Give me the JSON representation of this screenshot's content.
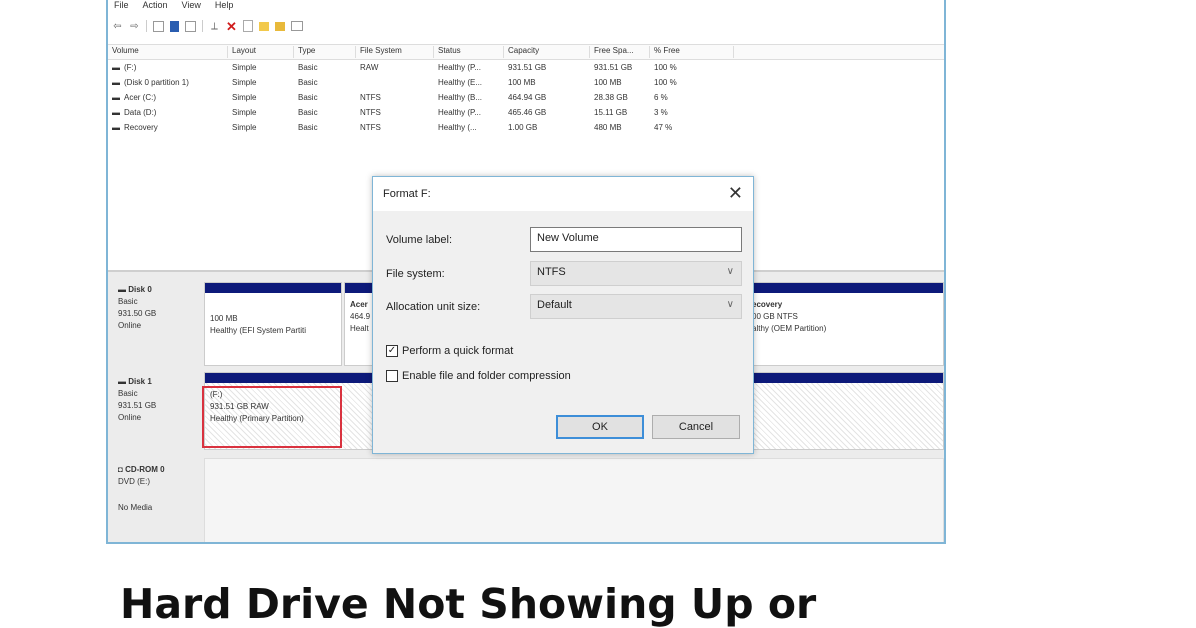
{
  "menubar": [
    "File",
    "Action",
    "View",
    "Help"
  ],
  "toolbar_icons": [
    "back-icon",
    "forward-icon",
    "console-tree-icon",
    "properties-icon",
    "help-icon",
    "connect-icon",
    "delete-icon",
    "checklist-icon",
    "folder-icon",
    "folder-open-icon",
    "window-icon"
  ],
  "volumes": {
    "columns": [
      "Volume",
      "Layout",
      "Type",
      "File System",
      "Status",
      "Capacity",
      "Free Spa...",
      "% Free"
    ],
    "rows": [
      [
        "(F:)",
        "Simple",
        "Basic",
        "RAW",
        "Healthy (P...",
        "931.51 GB",
        "931.51 GB",
        "100 %"
      ],
      [
        "(Disk 0 partition 1)",
        "Simple",
        "Basic",
        "",
        "Healthy (E...",
        "100 MB",
        "100 MB",
        "100 %"
      ],
      [
        "Acer (C:)",
        "Simple",
        "Basic",
        "NTFS",
        "Healthy (B...",
        "464.94 GB",
        "28.38 GB",
        "6 %"
      ],
      [
        "Data (D:)",
        "Simple",
        "Basic",
        "NTFS",
        "Healthy (P...",
        "465.46 GB",
        "15.11 GB",
        "3 %"
      ],
      [
        "Recovery",
        "Simple",
        "Basic",
        "NTFS",
        "Healthy (...",
        "1.00 GB",
        "480 MB",
        "47 %"
      ]
    ]
  },
  "disks": [
    {
      "name": "Disk 0",
      "type": "Basic",
      "size": "931.50 GB",
      "state": "Online",
      "partitions": [
        {
          "line1": "100 MB",
          "line2": "Healthy (EFI System Partiti"
        },
        {
          "line1": "Acer",
          "line2": "464.9",
          "line3": "Healt"
        },
        {
          "line1": "ecovery",
          "line2": "00 GB NTFS",
          "line3": "althy (OEM Partition)"
        }
      ]
    },
    {
      "name": "Disk 1",
      "type": "Basic",
      "size": "931.51 GB",
      "state": "Online",
      "partitions": [
        {
          "line1": "(F:)",
          "line2": "931.51 GB RAW",
          "line3": "Healthy (Primary Partition)"
        }
      ]
    },
    {
      "name": "CD-ROM 0",
      "type": "DVD (E:)",
      "state": "No Media"
    }
  ],
  "dialog": {
    "title": "Format F:",
    "volume_label_caption": "Volume label:",
    "volume_label_value": "New Volume",
    "file_system_caption": "File system:",
    "file_system_value": "NTFS",
    "alloc_caption": "Allocation unit size:",
    "alloc_value": "Default",
    "quick_format_label": "Perform a quick format",
    "quick_format_checked": true,
    "compression_label": "Enable file and folder compression",
    "compression_checked": false,
    "ok_label": "OK",
    "cancel_label": "Cancel"
  },
  "caption": "Hard Drive Not Showing Up or",
  "colors": {
    "partition_bar": "#0d1a7a",
    "highlight": "#d9323f",
    "window_border": "#7fb5d6"
  }
}
